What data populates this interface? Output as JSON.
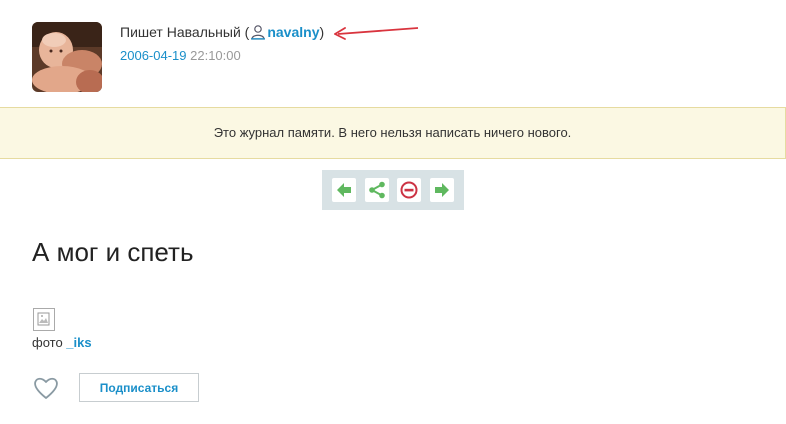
{
  "post": {
    "author_prefix": "Пишет Навальный (",
    "username": "navalny",
    "author_suffix": ")",
    "date": "2006-04-19",
    "time": "22:10:00",
    "title": "А мог и спеть",
    "photo_label": "фото ",
    "photo_credit": "_iks"
  },
  "notice": {
    "text": "Это журнал памяти. В него нельзя написать ничего нового."
  },
  "toolbar": {
    "icons": [
      "arrow-left-icon",
      "share-icon",
      "no-entry-icon",
      "arrow-right-icon"
    ]
  },
  "actions": {
    "subscribe_label": "Подписаться"
  },
  "colors": {
    "link": "#1a8fc9",
    "notice_bg": "#fbf8e3",
    "toolbar_bg": "#d8e2e5",
    "icon_green": "#5fb85f",
    "icon_red": "#cc3344",
    "annotation_arrow": "#d9343e"
  }
}
